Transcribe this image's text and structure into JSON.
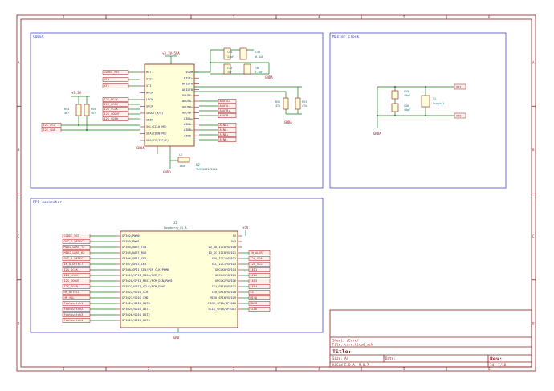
{
  "frame": {
    "columns": [
      "1",
      "2",
      "3",
      "4",
      "5",
      "6"
    ],
    "rows": [
      "A",
      "B",
      "C",
      "D"
    ]
  },
  "codec_block": {
    "title": "CODEC"
  },
  "clock_block": {
    "title": "Master clock"
  },
  "rpi_block": {
    "title": "RPI connector"
  },
  "codec": {
    "ref": "U2",
    "value": "TLV320AIC3204",
    "left_pins": [
      "RST",
      "XTO",
      "XTI",
      "MCLK",
      "LRCK",
      "SCLK",
      "SDOUT(M/S)",
      "SDIN",
      "SCL/CCLK(MC)",
      "SDA/CDIN(MC)",
      "AD0/CS(I2C/S)"
    ],
    "right_pins": [
      "VCOM",
      "FILT+",
      "AFILTA",
      "AFILTB",
      "AOUTA+",
      "AOUTA-",
      "AOUTB+",
      "AOUTB-",
      "AINA+",
      "AINA-",
      "AINB+",
      "AINB-"
    ],
    "top_pins": [
      "VA",
      "VD"
    ],
    "bottom_pins": [
      "AGND",
      "DGND"
    ]
  },
  "codec_parts": {
    "supply": "+3.3V+5VA",
    "c44": {
      "ref": "C44",
      "value": "47uF"
    },
    "c45": {
      "ref": "C45",
      "value": "0.1uF"
    },
    "c43": {
      "ref": "C43",
      "value": "1uF"
    },
    "c46": {
      "ref": "C46",
      "value": "0.1uF"
    },
    "gnd_top": "GNDA",
    "r53": {
      "ref": "R53",
      "value": "47k"
    },
    "r52": {
      "ref": "R52",
      "value": "47k"
    },
    "r54": {
      "ref": "R54",
      "value": "4k7"
    },
    "r55": {
      "ref": "R55",
      "value": "4k7"
    },
    "pullup_rail": "+3.3V",
    "gnd_r": "GNDA",
    "gnd_ic": "GNDA",
    "gnd_ic2": "GNDD",
    "l2": {
      "ref": "L2",
      "value": "10uH"
    }
  },
  "codec_nets": {
    "left": [
      "CODEC_RST",
      "XTO",
      "XTI",
      "I2S_MCLK",
      "I2S_LRCK",
      "I2S_SCLK",
      "I2S_SDOUT",
      "I2S_SDIN"
    ],
    "bus": [
      "I2C_SCL",
      "I2C_SDA"
    ],
    "right": [
      "AOUTA+",
      "AOUTA-",
      "AOUTB+",
      "AOUTB-",
      "AINA+",
      "AINA-",
      "AINB+",
      "AINB-"
    ]
  },
  "clock": {
    "c55": {
      "ref": "C55",
      "value": "40pF"
    },
    "c56": {
      "ref": "C56",
      "value": "40pF"
    },
    "y1": {
      "ref": "Y1",
      "value": "Crystal"
    },
    "net_xti": "XTI",
    "net_xto": "XTO",
    "gnd": "GNDA"
  },
  "rpi": {
    "ref": "J2",
    "value": "Raspberry_Pi_A",
    "rail_5v": "+5V",
    "gnd": "GND",
    "left_pins": [
      "GPIO2/PWM0",
      "GPIO3/PWM1",
      "GPIO4/UART_TXD",
      "GPIO5/UART_RXD",
      "GPIO6/SPI1_CE2",
      "GPIO7/SPI1_CE1",
      "GPIO8/SPI1_CE0/PCM_CLK/PWM0",
      "GPIO19/SPI1_MISO/PCM_FS",
      "GPIO20/SPI1_MOSI/PCM_DIN/PWM1",
      "GPIO21/SPI1_SCLK/PCM_DOUT",
      "GPIO22/SDIO_CLK",
      "GPIO23/SDIO_CMD",
      "GPIO24/SDIO_DAT0",
      "GPIO25/SDIO_DAT1",
      "GPIO26/SDIO_DAT2",
      "GPIO27/SDIO_DAT3"
    ],
    "right_pins": [
      "5V",
      "3V3",
      "ID_SD_I2C0/GPIO0",
      "ID_SC_I2C0/GPIO1",
      "SDA_I2C1/GPIO2",
      "SCL_I2C1/GPIO3",
      "GPCLK0/GPIO4",
      "GPCLK1/GPIO5",
      "GPCLK2/GPIO6",
      "CE1_SPI0/GPIO7",
      "CE0_SPI0/GPIO8",
      "MISO_SPI0/GPIO9",
      "MOSI_SPI0/GPIO10",
      "SCLK_SPI0/GPIO11"
    ],
    "left_nets": [
      "CODEC_RST",
      "OUT_A_DETECT",
      "MIDI_UART_TX",
      "MIDI_UART_RX",
      "OUT_A_DETECT",
      "IN_A_DETECT",
      "I2S_SCLK",
      "I2S_LRCK",
      "I2S_SDOUT",
      "I2S_SDIN",
      "HP_DETECT",
      "HP_VOL",
      "Footswitch1",
      "Footswitch2",
      "Footswitch3",
      "Footswitch4"
    ],
    "right_nets": [
      "IN_ALERT",
      "I2C_SDA",
      "I2C_SCL",
      "LED1",
      "LED2",
      "LED3",
      "LED4",
      "CS",
      "MISO",
      "MOSI",
      "SCLK"
    ]
  },
  "title_block": {
    "sheet_label": "Sheet: /Core/",
    "file_label": "File: core.kicad_sch",
    "title_label": "Title:",
    "size_label": "Size: A4",
    "date_label": "Date:",
    "rev_label": "Rev:",
    "tool_label": "KiCad E.D.A. 9.0.7",
    "id_label": "Id: 7/10"
  }
}
